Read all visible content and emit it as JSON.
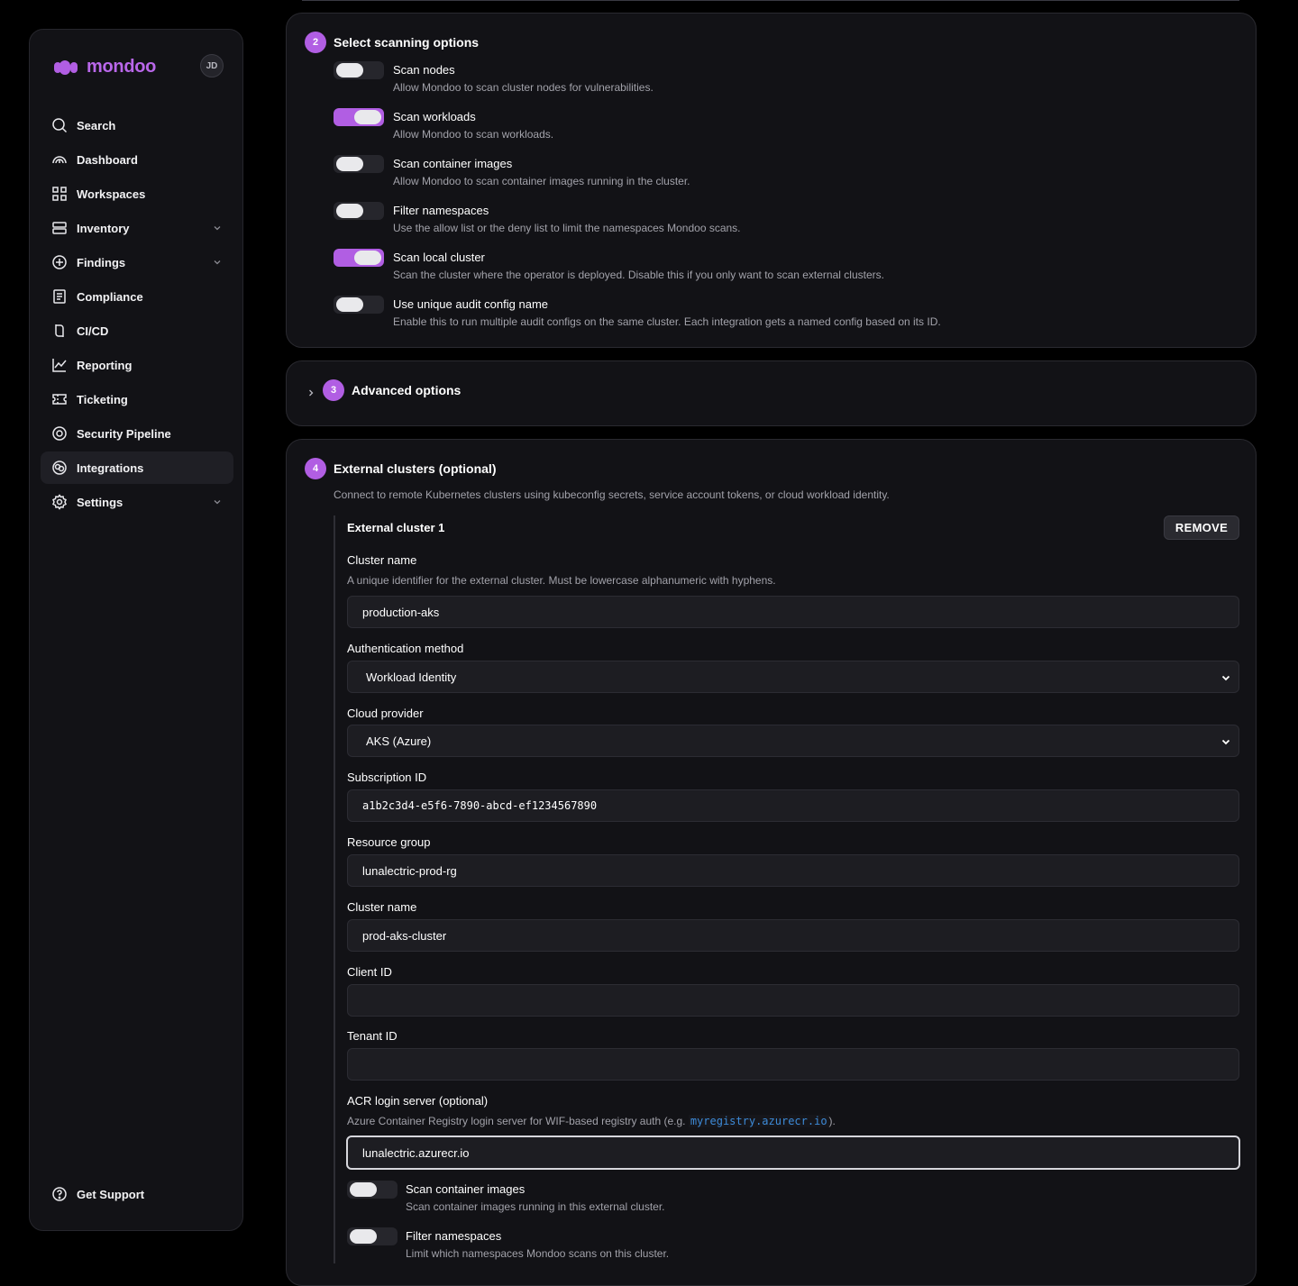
{
  "brand": {
    "name": "mondoo",
    "accent": "#b15ee3"
  },
  "user": {
    "initials": "JD"
  },
  "sidebar": {
    "items": [
      {
        "label": "Search",
        "icon": "search-icon"
      },
      {
        "label": "Dashboard",
        "icon": "gauge-icon"
      },
      {
        "label": "Workspaces",
        "icon": "grid-icon"
      },
      {
        "label": "Inventory",
        "icon": "server-icon",
        "expandable": true
      },
      {
        "label": "Findings",
        "icon": "plus-circle-icon",
        "expandable": true
      },
      {
        "label": "Compliance",
        "icon": "checklist-icon"
      },
      {
        "label": "CI/CD",
        "icon": "pipeline-icon"
      },
      {
        "label": "Reporting",
        "icon": "chart-line-icon"
      },
      {
        "label": "Ticketing",
        "icon": "ticket-icon"
      },
      {
        "label": "Security Pipeline",
        "icon": "target-icon"
      },
      {
        "label": "Integrations",
        "icon": "integrations-icon",
        "active": true
      },
      {
        "label": "Settings",
        "icon": "gear-icon",
        "expandable": true
      }
    ],
    "support": {
      "label": "Get Support",
      "icon": "help-circle-icon"
    }
  },
  "scanning": {
    "step": "2",
    "title": "Select scanning options",
    "options": [
      {
        "label": "Scan nodes",
        "desc": "Allow Mondoo to scan cluster nodes for vulnerabilities.",
        "on": false
      },
      {
        "label": "Scan workloads",
        "desc": "Allow Mondoo to scan workloads.",
        "on": true
      },
      {
        "label": "Scan container images",
        "desc": "Allow Mondoo to scan container images running in the cluster.",
        "on": false
      },
      {
        "label": "Filter namespaces",
        "desc": "Use the allow list or the deny list to limit the namespaces Mondoo scans.",
        "on": false
      },
      {
        "label": "Scan local cluster",
        "desc": "Scan the cluster where the operator is deployed. Disable this if you only want to scan external clusters.",
        "on": true
      },
      {
        "label": "Use unique audit config name",
        "desc": "Enable this to run multiple audit configs on the same cluster. Each integration gets a named config based on its ID.",
        "on": false
      }
    ]
  },
  "advanced": {
    "step": "3",
    "title": "Advanced options"
  },
  "external": {
    "step": "4",
    "title": "External clusters (optional)",
    "description": "Connect to remote Kubernetes clusters using kubeconfig secrets, service account tokens, or cloud workload identity.",
    "cluster": {
      "title": "External cluster 1",
      "remove_label": "REMOVE",
      "cluster_name": {
        "label": "Cluster name",
        "help": "A unique identifier for the external cluster. Must be lowercase alphanumeric with hyphens.",
        "value": "production-aks"
      },
      "auth_method": {
        "label": "Authentication method",
        "value": "Workload Identity"
      },
      "cloud_provider": {
        "label": "Cloud provider",
        "value": "AKS (Azure)"
      },
      "subscription_id": {
        "label": "Subscription ID",
        "value": "a1b2c3d4-e5f6-7890-abcd-ef1234567890"
      },
      "resource_group": {
        "label": "Resource group",
        "value": "lunalectric-prod-rg"
      },
      "aks_cluster_name": {
        "label": "Cluster name",
        "value": "prod-aks-cluster"
      },
      "client_id": {
        "label": "Client ID",
        "value": ""
      },
      "tenant_id": {
        "label": "Tenant ID",
        "value": ""
      },
      "acr": {
        "label": "ACR login server (optional)",
        "help_prefix": "Azure Container Registry login server for WIF-based registry auth (e.g. ",
        "help_code": "myregistry.azurecr.io",
        "help_suffix": ").",
        "value": "lunalectric.azurecr.io"
      },
      "toggles": [
        {
          "label": "Scan container images",
          "desc": "Scan container images running in this external cluster.",
          "on": false
        },
        {
          "label": "Filter namespaces",
          "desc": "Limit which namespaces Mondoo scans on this cluster.",
          "on": false
        }
      ]
    }
  }
}
